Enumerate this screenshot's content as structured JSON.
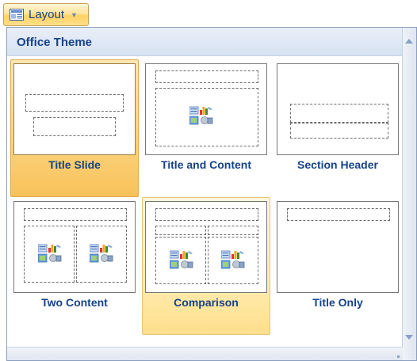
{
  "button": {
    "label": "Layout",
    "icon": "layout-icon"
  },
  "group": {
    "title": "Office Theme"
  },
  "layouts": [
    {
      "label": "Title Slide",
      "state": "selected"
    },
    {
      "label": "Title and Content",
      "state": "normal"
    },
    {
      "label": "Section Header",
      "state": "normal"
    },
    {
      "label": "Two Content",
      "state": "normal"
    },
    {
      "label": "Comparison",
      "state": "hover"
    },
    {
      "label": "Title Only",
      "state": "normal"
    }
  ]
}
